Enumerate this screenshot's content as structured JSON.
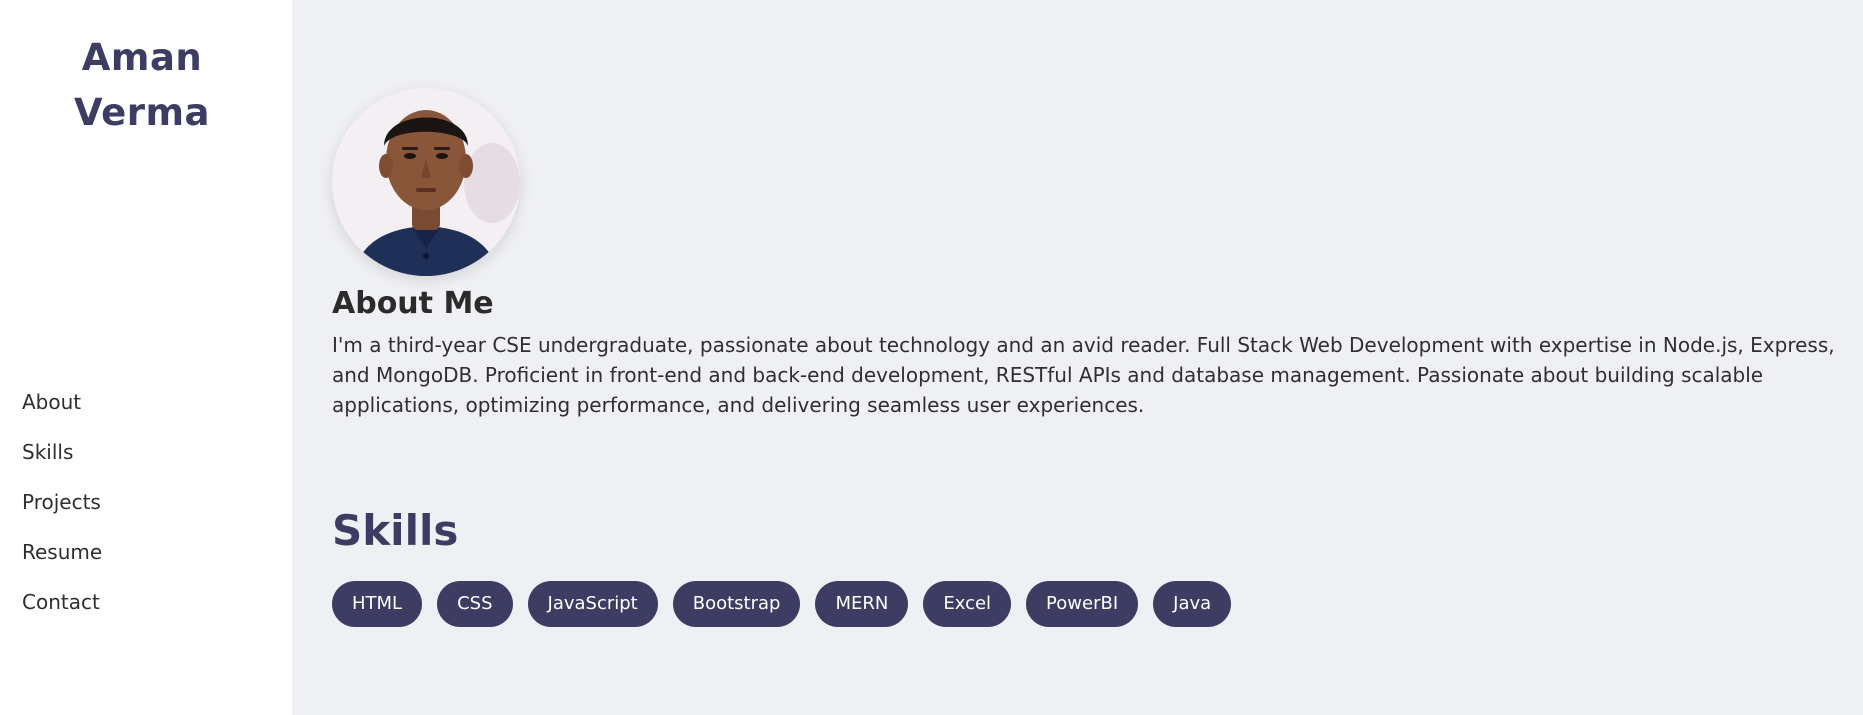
{
  "sidebar": {
    "name_line1": "Aman",
    "name_line2": "Verma",
    "nav": [
      {
        "label": "About"
      },
      {
        "label": "Skills"
      },
      {
        "label": "Projects"
      },
      {
        "label": "Resume"
      },
      {
        "label": "Contact"
      }
    ]
  },
  "about": {
    "title": "About Me",
    "text": "I'm a third-year CSE undergraduate, passionate about technology and an avid reader. Full Stack Web Development with expertise in Node.js, Express, and MongoDB. Proficient in front-end and back-end development, RESTful APIs and database management. Passionate about building scalable applications, optimizing performance, and delivering seamless user experiences.",
    "avatar_icon": "profile-photo"
  },
  "skills": {
    "title": "Skills",
    "items": [
      "HTML",
      "CSS",
      "JavaScript",
      "Bootstrap",
      "MERN",
      "Excel",
      "PowerBI",
      "Java"
    ]
  },
  "colors": {
    "accent": "#3d3c63",
    "background": "#eff0f4",
    "sidebar": "#ffffff"
  }
}
